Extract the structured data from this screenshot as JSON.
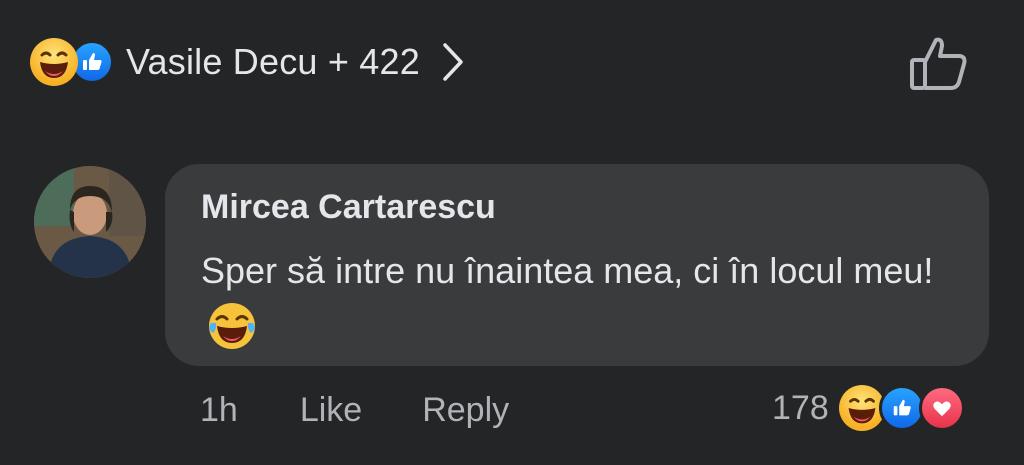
{
  "reactions_header": {
    "reactors_text": "Vasile Decu + 422",
    "icons": [
      "haha-icon",
      "like-icon"
    ]
  },
  "comment": {
    "author": "Mircea Cartarescu",
    "text": "Sper să intre nu înaintea mea, ci în locul meu!",
    "emoji": "laughing-tears-icon"
  },
  "actions": {
    "time": "1h",
    "like_label": "Like",
    "reply_label": "Reply",
    "reaction_count": "178",
    "reaction_icons": [
      "haha-icon",
      "like-icon",
      "love-icon"
    ]
  },
  "colors": {
    "background": "#242526",
    "bubble": "#3a3b3c",
    "text": "#e4e6eb",
    "secondary": "#b0b3b8",
    "like_blue": "#1877f2",
    "love_red": "#f02849"
  }
}
